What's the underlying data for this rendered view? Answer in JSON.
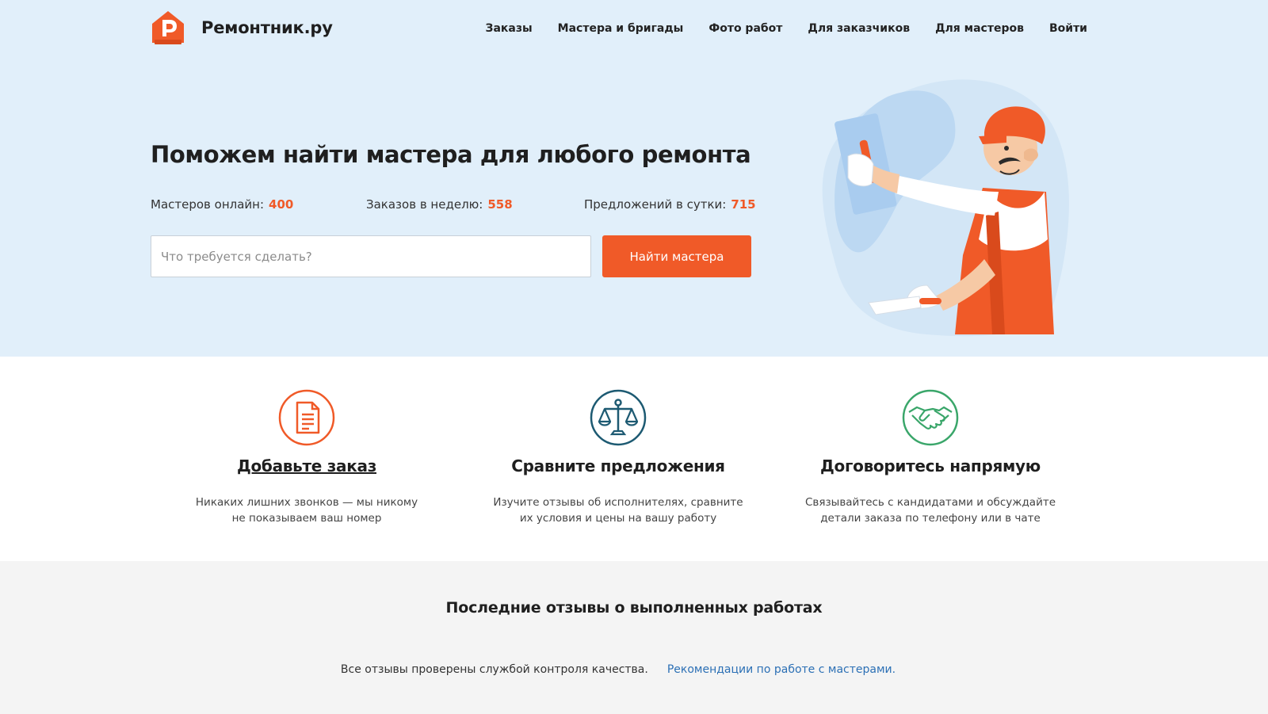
{
  "header": {
    "brand": "Ремонтник.ру",
    "nav": [
      "Заказы",
      "Мастера и бригады",
      "Фото работ",
      "Для заказчиков",
      "Для мастеров",
      "Войти"
    ]
  },
  "hero": {
    "title": "Поможем найти мастера для любого ремонта",
    "stats": [
      {
        "label": "Мастеров онлайн:",
        "value": "400"
      },
      {
        "label": "Заказов в неделю:",
        "value": "558"
      },
      {
        "label": "Предложений в сутки:",
        "value": "715"
      }
    ],
    "search": {
      "placeholder": "Что требуется сделать?",
      "value": ""
    },
    "button": "Найти мастера"
  },
  "steps": [
    {
      "icon": "document-icon",
      "title": "Добавьте заказ",
      "line1": "Никаких лишних звонков — мы никому",
      "line2": "не показываем ваш номер"
    },
    {
      "icon": "scales-icon",
      "title": "Сравните предложения",
      "line1": "Изучите отзывы об исполнителях, сравните",
      "line2": "их условия и цены на вашу работу"
    },
    {
      "icon": "handshake-icon",
      "title": "Договоритесь напрямую",
      "line1": "Связывайтесь с кандидатами и обсуждайте",
      "line2": "детали заказа по телефону или в чате"
    }
  ],
  "reviews": {
    "title": "Последние отзывы о выполненных работах",
    "note": "Все отзывы проверены службой контроля качества.",
    "link": "Рекомендации по работе с мастерами."
  },
  "colors": {
    "accent": "#f05a28",
    "hero_bg": "#e1effa",
    "scales_icon": "#1d5a72",
    "handshake_icon": "#3aa66a",
    "link": "#2c70b5"
  }
}
